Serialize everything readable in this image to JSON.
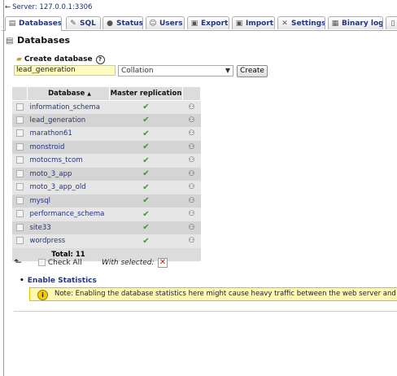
{
  "server": {
    "label": "Server: 127.0.0.1:3306"
  },
  "tabs": [
    {
      "label": "Databases",
      "icon": "database-icon",
      "active": true
    },
    {
      "label": "SQL",
      "icon": "sql-icon"
    },
    {
      "label": "Status",
      "icon": "status-icon"
    },
    {
      "label": "Users",
      "icon": "users-icon"
    },
    {
      "label": "Export",
      "icon": "export-icon"
    },
    {
      "label": "Import",
      "icon": "import-icon"
    },
    {
      "label": "Settings",
      "icon": "settings-icon"
    },
    {
      "label": "Binary log",
      "icon": "binary-log-icon"
    }
  ],
  "page_title": "Databases",
  "create": {
    "label": "Create database",
    "help": "?",
    "db_name_value": "lead_generation",
    "collation_value": "Collation",
    "button_label": "Create"
  },
  "table": {
    "col_database": "Database",
    "sort_indicator": "▲",
    "col_replication": "Master replication",
    "rows": [
      "information_schema",
      "lead_generation",
      "marathon61",
      "monstroid",
      "motocms_tcom",
      "moto_3_app",
      "moto_3_app_old",
      "mysql",
      "performance_schema",
      "site33",
      "wordpress"
    ],
    "total_label": "Total: 11"
  },
  "footer": {
    "check_all": "Check All",
    "with_selected": "With selected:"
  },
  "enable_statistics": "Enable Statistics",
  "notice": "Note: Enabling the database statistics here might cause heavy traffic between the web server and the MySQL server.",
  "colors": {
    "link": "#23357c",
    "check": "#3b9a2c",
    "notice_bg": "#fff8b0",
    "delete": "#c0201a"
  }
}
